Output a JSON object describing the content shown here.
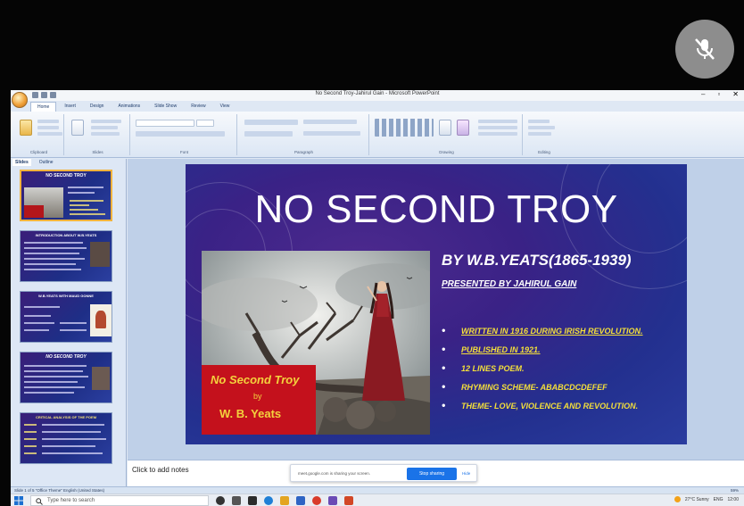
{
  "window": {
    "title": "No Second Troy-Jahirul Gain - Microsoft PowerPoint"
  },
  "ribbon": {
    "tabs": [
      "Home",
      "Insert",
      "Design",
      "Animations",
      "Slide Show",
      "Review",
      "View"
    ],
    "groups": [
      "Clipboard",
      "Slides",
      "Font",
      "Paragraph",
      "Drawing",
      "Editing"
    ]
  },
  "pane": {
    "tabs": [
      "Slides",
      "Outline"
    ],
    "thumbs": [
      {
        "num": "1",
        "title": "NO SECOND TROY"
      },
      {
        "num": "2",
        "title": "INTRODUCTION ABOUT W.B.YEATS"
      },
      {
        "num": "3",
        "title": "W.B.YEATS WITH MAUD GONNE"
      },
      {
        "num": "4",
        "title": "NO SECOND TROY"
      },
      {
        "num": "5",
        "title": "CRITICAL ANALYSIS OF THE POEM"
      }
    ]
  },
  "slide": {
    "title": "NO SECOND TROY",
    "byline": "BY W.B.YEATS(1865-1939)",
    "presenter": "PRESENTED BY JAHIRUL GAIN",
    "bullets": [
      "WRITTEN IN 1916 DURING IRISH REVOLUTION.",
      "PUBLISHED IN 1921.",
      "12 LINES POEM.",
      "RHYMING SCHEME-   ABABCDCDEFEF",
      "THEME-  LOVE, VIOLENCE  AND REVOLUTION."
    ],
    "art_title": "No Second Troy",
    "art_by": "by",
    "art_author": "W. B. Yeats"
  },
  "notes": {
    "placeholder": "Click to add notes"
  },
  "share": {
    "message": "meet.google.com is sharing your screen.",
    "stop_label": "Stop sharing",
    "hide_label": "Hide"
  },
  "status": {
    "left": "Slide 1 of 5   \"Office Theme\"   English (United States)",
    "right": "59%"
  },
  "taskbar": {
    "search_placeholder": "Type here to search",
    "weather": "27°C  Sunny",
    "language": "ENG",
    "time": "12:00"
  },
  "colors": {
    "slide_bg": "#3a2286",
    "bullet_text": "#f4df3a",
    "art_box": "#c4111c",
    "stop_button": "#1a73e8"
  },
  "icons": [
    "mic-off-icon",
    "office-button-icon",
    "windows-start-icon",
    "search-icon",
    "weather-sun-icon"
  ]
}
